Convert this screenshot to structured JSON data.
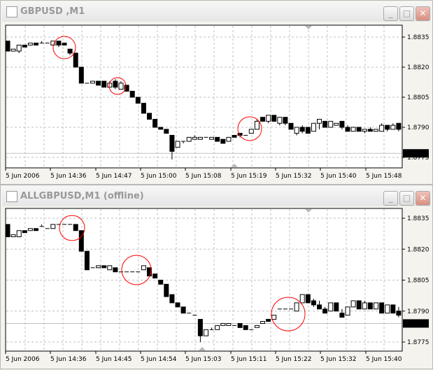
{
  "windows": [
    {
      "title": "GBPUSD ,M1",
      "last_price": "1.8777",
      "last_value": 1.8777,
      "price_labels": [
        "1.8835",
        "1.8820",
        "1.8805",
        "1.8790",
        "1.8775"
      ],
      "time_labels": [
        "5 Jun 2006",
        "5 Jun 14:36",
        "5 Jun 14:47",
        "5 Jun 15:00",
        "5 Jun 15:08",
        "5 Jun 15:19",
        "5 Jun 15:32",
        "5 Jun 15:40",
        "5 Jun 15:48"
      ]
    },
    {
      "title": "ALLGBPUSD,M1 (offline)",
      "last_price": "1.8784",
      "last_value": 1.8784,
      "price_labels": [
        "1.8835",
        "1.8820",
        "1.8805",
        "1.8790",
        "1.8775"
      ],
      "time_labels": [
        "5 Jun 2006",
        "5 Jun 14:36",
        "5 Jun 14:45",
        "5 Jun 14:54",
        "5 Jun 15:03",
        "5 Jun 15:11",
        "5 Jun 15:22",
        "5 Jun 15:32",
        "5 Jun 15:40"
      ]
    }
  ],
  "buttons": {
    "minimize": "_",
    "maximize": "□",
    "close": "✕"
  },
  "chart_data": [
    {
      "type": "candlestick",
      "title": "GBPUSD ,M1",
      "ylim": [
        1.8772,
        1.8841
      ],
      "yticks": [
        1.8835,
        1.882,
        1.8805,
        1.879,
        1.8775
      ],
      "ohlc": [
        [
          1.8833,
          1.8833,
          1.8828,
          1.8828
        ],
        [
          1.8828,
          1.8829,
          1.8828,
          1.8829
        ],
        [
          1.8828,
          1.8831,
          1.8827,
          1.8831
        ],
        [
          1.8831,
          1.8831,
          1.883,
          1.883
        ],
        [
          1.8831,
          1.8832,
          1.8831,
          1.8832
        ],
        [
          1.8832,
          1.8832,
          1.8831,
          1.8831
        ],
        [
          1.8832,
          1.8833,
          1.8832,
          1.8832
        ],
        [
          1.8832,
          1.8832,
          1.8832,
          1.8832
        ],
        [
          1.8831,
          1.8833,
          1.8831,
          1.8833
        ],
        [
          1.8833,
          1.8833,
          1.883,
          1.8831
        ],
        [
          1.8832,
          1.8832,
          1.8831,
          1.8831
        ],
        [
          1.8829,
          1.8829,
          1.8826,
          1.8827
        ],
        [
          1.8827,
          1.8827,
          1.882,
          1.882
        ],
        [
          1.882,
          1.882,
          1.8812,
          1.8812
        ],
        [
          1.8812,
          1.8812,
          1.8812,
          1.8812
        ],
        [
          1.8812,
          1.8813,
          1.8812,
          1.8813
        ],
        [
          1.8813,
          1.8813,
          1.8811,
          1.8811
        ],
        [
          1.8813,
          1.8813,
          1.881,
          1.881
        ],
        [
          1.881,
          1.8813,
          1.881,
          1.8812
        ],
        [
          1.8813,
          1.8814,
          1.8809,
          1.881
        ],
        [
          1.8809,
          1.8813,
          1.8809,
          1.8812
        ],
        [
          1.8811,
          1.8811,
          1.8808,
          1.8808
        ],
        [
          1.8808,
          1.8808,
          1.8805,
          1.8805
        ],
        [
          1.8805,
          1.8805,
          1.8802,
          1.8802
        ],
        [
          1.8802,
          1.8802,
          1.8797,
          1.8797
        ],
        [
          1.8797,
          1.8797,
          1.8794,
          1.8794
        ],
        [
          1.8794,
          1.8794,
          1.879,
          1.879
        ],
        [
          1.879,
          1.879,
          1.8789,
          1.8789
        ],
        [
          1.8789,
          1.8789,
          1.8787,
          1.8787
        ],
        [
          1.8786,
          1.8786,
          1.8774,
          1.8778
        ],
        [
          1.878,
          1.8783,
          1.878,
          1.8783
        ],
        [
          1.8783,
          1.8783,
          1.8782,
          1.8783
        ],
        [
          1.8783,
          1.8785,
          1.8783,
          1.8785
        ],
        [
          1.8784,
          1.8786,
          1.8784,
          1.8785
        ],
        [
          1.8784,
          1.8785,
          1.8784,
          1.8785
        ],
        [
          1.8785,
          1.8785,
          1.8785,
          1.8785
        ],
        [
          1.8784,
          1.8785,
          1.8784,
          1.8785
        ],
        [
          1.8785,
          1.8785,
          1.8783,
          1.8783
        ],
        [
          1.8784,
          1.8784,
          1.8782,
          1.8782
        ],
        [
          1.8783,
          1.8785,
          1.8783,
          1.8785
        ],
        [
          1.8786,
          1.8786,
          1.8785,
          1.8785
        ],
        [
          1.8787,
          1.8787,
          1.8785,
          1.8786
        ],
        [
          1.8786,
          1.8786,
          1.8786,
          1.8786
        ],
        [
          1.8787,
          1.8789,
          1.8787,
          1.8789
        ],
        [
          1.8789,
          1.8794,
          1.8789,
          1.8793
        ],
        [
          1.8795,
          1.8795,
          1.8793,
          1.8793
        ],
        [
          1.8793,
          1.8796,
          1.8792,
          1.8796
        ],
        [
          1.8796,
          1.8796,
          1.8793,
          1.8793
        ],
        [
          1.8792,
          1.8795,
          1.8791,
          1.8795
        ],
        [
          1.8795,
          1.8795,
          1.8791,
          1.8792
        ],
        [
          1.8792,
          1.8792,
          1.8789,
          1.8789
        ],
        [
          1.8787,
          1.879,
          1.8786,
          1.879
        ],
        [
          1.879,
          1.8791,
          1.8787,
          1.8788
        ],
        [
          1.879,
          1.879,
          1.8787,
          1.8787
        ],
        [
          1.8788,
          1.8792,
          1.8788,
          1.8792
        ],
        [
          1.8792,
          1.8794,
          1.8789,
          1.8794
        ],
        [
          1.8793,
          1.8793,
          1.879,
          1.879
        ],
        [
          1.879,
          1.8793,
          1.879,
          1.8793
        ],
        [
          1.8791,
          1.8792,
          1.8791,
          1.8792
        ],
        [
          1.8793,
          1.8793,
          1.8789,
          1.879
        ],
        [
          1.879,
          1.8791,
          1.8788,
          1.8788
        ],
        [
          1.8788,
          1.879,
          1.8788,
          1.879
        ],
        [
          1.879,
          1.879,
          1.8788,
          1.8788
        ],
        [
          1.8788,
          1.8789,
          1.8787,
          1.8789
        ],
        [
          1.8789,
          1.879,
          1.8788,
          1.8788
        ],
        [
          1.8788,
          1.8789,
          1.8788,
          1.8789
        ],
        [
          1.8788,
          1.8792,
          1.8788,
          1.8791
        ],
        [
          1.8791,
          1.8791,
          1.8788,
          1.8789
        ],
        [
          1.8789,
          1.8792,
          1.8789,
          1.8791
        ],
        [
          1.8792,
          1.8792,
          1.8788,
          1.8789
        ]
      ]
    },
    {
      "type": "candlestick",
      "title": "ALLGBPUSD,M1 (offline)",
      "ylim": [
        1.877,
        1.884
      ],
      "yticks": [
        1.8835,
        1.882,
        1.8805,
        1.879,
        1.8775
      ],
      "ohlc": [
        [
          1.8832,
          1.8832,
          1.8826,
          1.8826
        ],
        [
          1.8826,
          1.8827,
          1.8826,
          1.8827
        ],
        [
          1.8826,
          1.8829,
          1.8826,
          1.8829
        ],
        [
          1.8829,
          1.8829,
          1.8828,
          1.8828
        ],
        [
          1.8829,
          1.883,
          1.8829,
          1.883
        ],
        [
          1.883,
          1.883,
          1.8829,
          1.8829
        ],
        [
          1.8831,
          1.8832,
          1.8831,
          1.8831
        ],
        [
          1.883,
          1.883,
          1.883,
          1.883
        ],
        [
          1.883,
          1.8832,
          1.883,
          1.8832
        ],
        [
          1.8832,
          1.8832,
          1.8832,
          1.8832
        ],
        [
          1.8832,
          1.8832,
          1.8832,
          1.8832
        ],
        [
          1.8832,
          1.8832,
          1.8832,
          1.8832
        ],
        [
          1.8832,
          1.8832,
          1.8829,
          1.8829
        ],
        [
          1.8829,
          1.8829,
          1.8819,
          1.8819
        ],
        [
          1.8819,
          1.8819,
          1.881,
          1.881
        ],
        [
          1.8811,
          1.8811,
          1.8811,
          1.8811
        ],
        [
          1.8811,
          1.8812,
          1.8811,
          1.8812
        ],
        [
          1.8812,
          1.8812,
          1.8811,
          1.8811
        ],
        [
          1.881,
          1.8812,
          1.881,
          1.8812
        ],
        [
          1.8811,
          1.8811,
          1.8809,
          1.8809
        ],
        [
          1.8809,
          1.8809,
          1.8809,
          1.8809
        ],
        [
          1.8809,
          1.8809,
          1.8809,
          1.8809
        ],
        [
          1.8809,
          1.8809,
          1.8809,
          1.8809
        ],
        [
          1.8809,
          1.8809,
          1.8809,
          1.8809
        ],
        [
          1.881,
          1.8812,
          1.881,
          1.8812
        ],
        [
          1.8811,
          1.8811,
          1.8807,
          1.8807
        ],
        [
          1.8808,
          1.8808,
          1.8806,
          1.8806
        ],
        [
          1.8805,
          1.8805,
          1.8803,
          1.8803
        ],
        [
          1.8803,
          1.8803,
          1.8797,
          1.8797
        ],
        [
          1.8798,
          1.8798,
          1.8794,
          1.8794
        ],
        [
          1.8794,
          1.8794,
          1.8792,
          1.8792
        ],
        [
          1.8792,
          1.8792,
          1.8789,
          1.8789
        ],
        [
          1.8789,
          1.8789,
          1.8789,
          1.8789
        ],
        [
          1.8788,
          1.8788,
          1.8788,
          1.8788
        ],
        [
          1.8786,
          1.8786,
          1.8775,
          1.8778
        ],
        [
          1.8778,
          1.8781,
          1.8778,
          1.8781
        ],
        [
          1.8781,
          1.8782,
          1.8781,
          1.8781
        ],
        [
          1.8781,
          1.8783,
          1.8781,
          1.8783
        ],
        [
          1.8783,
          1.8784,
          1.8783,
          1.8784
        ],
        [
          1.8783,
          1.8784,
          1.8783,
          1.8784
        ],
        [
          1.8783,
          1.8783,
          1.8783,
          1.8783
        ],
        [
          1.8784,
          1.8784,
          1.8782,
          1.8782
        ],
        [
          1.8783,
          1.8783,
          1.8781,
          1.8781
        ],
        [
          1.8781,
          1.8781,
          1.8781,
          1.8781
        ],
        [
          1.8782,
          1.8783,
          1.8782,
          1.8783
        ],
        [
          1.8784,
          1.8785,
          1.8784,
          1.8785
        ],
        [
          1.8786,
          1.8786,
          1.8785,
          1.8785
        ],
        [
          1.8786,
          1.8788,
          1.8786,
          1.8788
        ],
        [
          1.8791,
          1.8791,
          1.8791,
          1.8791
        ],
        [
          1.8791,
          1.8791,
          1.8791,
          1.8791
        ],
        [
          1.8791,
          1.8791,
          1.8791,
          1.8791
        ],
        [
          1.879,
          1.8794,
          1.879,
          1.8794
        ],
        [
          1.8794,
          1.8798,
          1.8794,
          1.8798
        ],
        [
          1.8798,
          1.8798,
          1.8794,
          1.8794
        ],
        [
          1.8795,
          1.8796,
          1.8792,
          1.8793
        ],
        [
          1.8793,
          1.8795,
          1.8791,
          1.8791
        ],
        [
          1.8791,
          1.8792,
          1.8789,
          1.8789
        ],
        [
          1.879,
          1.8794,
          1.879,
          1.8794
        ],
        [
          1.8794,
          1.8794,
          1.879,
          1.879
        ],
        [
          1.8789,
          1.8791,
          1.8787,
          1.8787
        ],
        [
          1.8788,
          1.8792,
          1.8788,
          1.8792
        ],
        [
          1.8792,
          1.8795,
          1.8792,
          1.8795
        ],
        [
          1.8795,
          1.8795,
          1.8791,
          1.8791
        ],
        [
          1.8791,
          1.8795,
          1.8791,
          1.8794
        ],
        [
          1.8794,
          1.8794,
          1.8791,
          1.8791
        ],
        [
          1.8791,
          1.8794,
          1.8791,
          1.8794
        ],
        [
          1.8794,
          1.8794,
          1.8789,
          1.8789
        ],
        [
          1.8789,
          1.8793,
          1.8789,
          1.8793
        ],
        [
          1.8793,
          1.8793,
          1.8789,
          1.8789
        ],
        [
          1.879,
          1.8792,
          1.8787,
          1.8788
        ]
      ]
    }
  ]
}
